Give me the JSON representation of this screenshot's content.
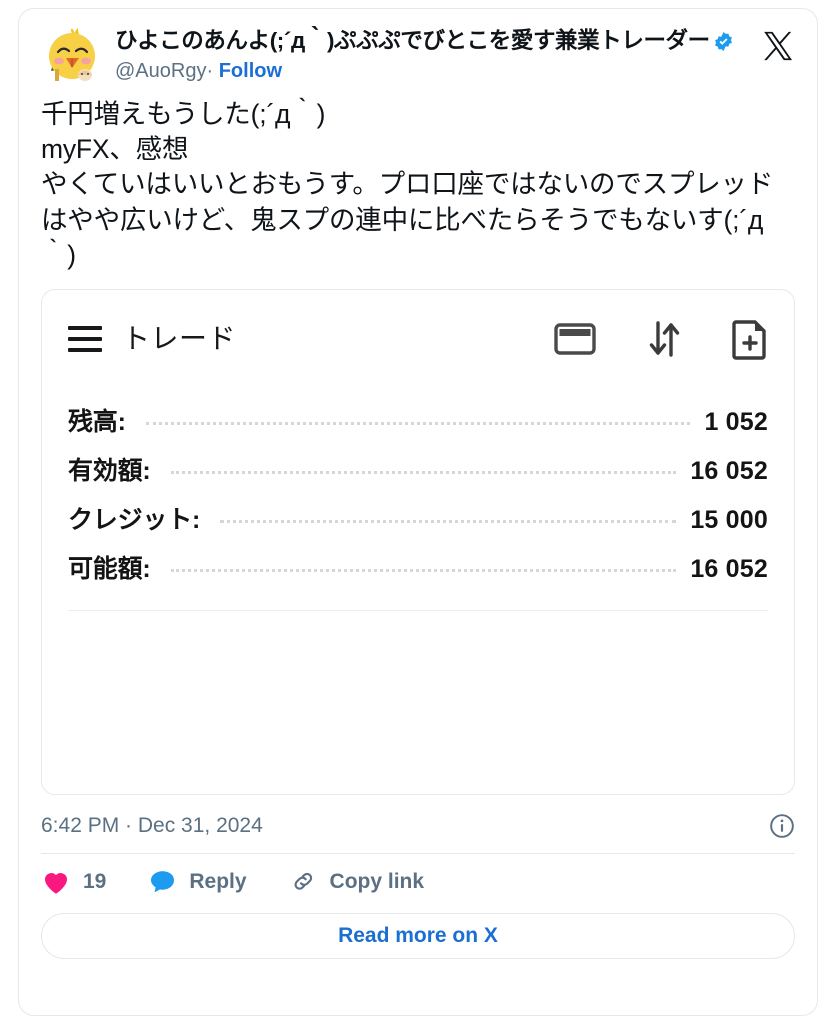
{
  "tweet": {
    "author": {
      "display_name": "ひよこのあんよ(;´д｀)ぷぷぷでびとこを愛す兼業トレーダー",
      "handle": "@AuoRgy",
      "separator": "·",
      "follow_label": "Follow",
      "verified": true,
      "avatar_icon": "chick-avatar"
    },
    "brand_icon": "x-logo",
    "body": "千円増えもうした(;´д｀)\nmyFX、感想\nやくていはいいとおもうす。プロ口座ではないのでスプレッドはやや広いけど、鬼スプの連中に比べたらそうでもないす(;´д｀)",
    "timestamp": "6:42 PM · Dec 31, 2024",
    "info_icon": "info-circle-icon",
    "actions": {
      "like": {
        "icon": "heart-icon",
        "count": "19"
      },
      "reply": {
        "icon": "speech-bubble-icon",
        "label": "Reply"
      },
      "copy_link": {
        "icon": "link-icon",
        "label": "Copy link"
      }
    },
    "read_more_label": "Read more on X"
  },
  "embedded_app": {
    "menu_icon": "hamburger-menu-icon",
    "title": "トレード",
    "toolbar_icons": [
      {
        "name": "credit-card-icon"
      },
      {
        "name": "sort-arrows-icon"
      },
      {
        "name": "new-document-icon"
      }
    ],
    "rows": [
      {
        "label": "残高:",
        "value": "1 052"
      },
      {
        "label": "有効額:",
        "value": "16 052"
      },
      {
        "label": "クレジット:",
        "value": "15 000"
      },
      {
        "label": "可能額:",
        "value": "16 052"
      }
    ]
  },
  "colors": {
    "link_blue": "#1d6fd4",
    "verified_blue": "#1d9bf0",
    "like_pink": "#f91880",
    "reply_blue": "#1d9bf0",
    "text_primary": "#0f1419",
    "text_muted": "#5b7083",
    "border": "#e6e8ea"
  }
}
